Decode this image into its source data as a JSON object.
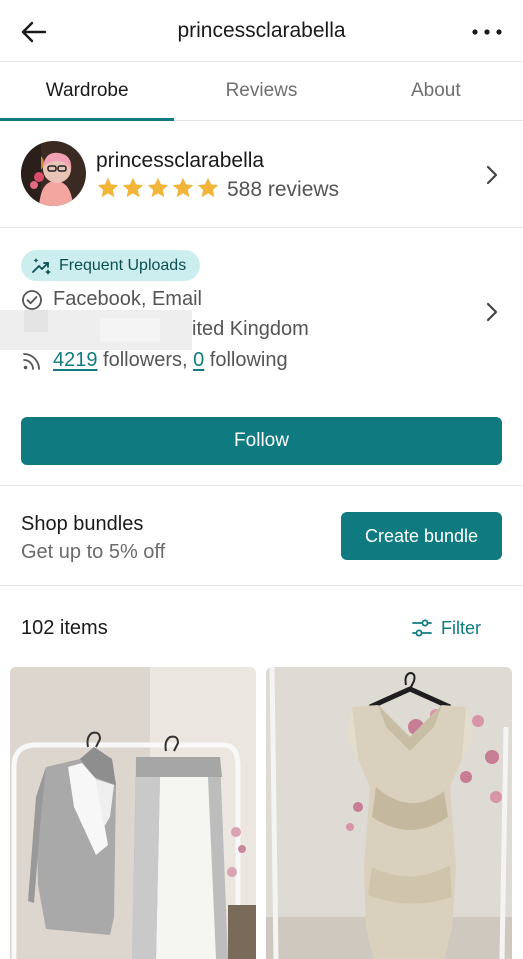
{
  "header": {
    "title": "princessclarabella",
    "back_icon": "arrow-left-icon",
    "more_icon": "more-horizontal-icon"
  },
  "tabs": [
    {
      "label": "Wardrobe",
      "active": true
    },
    {
      "label": "Reviews",
      "active": false
    },
    {
      "label": "About",
      "active": false
    }
  ],
  "profile": {
    "username": "princessclarabella",
    "rating": 5,
    "reviews": "588 reviews"
  },
  "info": {
    "badge": "Frequent Uploads",
    "verified": "Facebook, Email",
    "location_visible": "ited Kingdom",
    "followers_count": "4219",
    "followers_label": " followers, ",
    "following_count": "0",
    "following_label": " following"
  },
  "follow_button": "Follow",
  "bundles": {
    "title": "Shop bundles",
    "subtitle": "Get up to 5% off",
    "button": "Create bundle"
  },
  "items": {
    "count": "102 items",
    "filter_label": "Filter"
  },
  "colors": {
    "accent": "#0f7b80",
    "star": "#f2b53a",
    "badge_bg": "#cdeeee"
  }
}
